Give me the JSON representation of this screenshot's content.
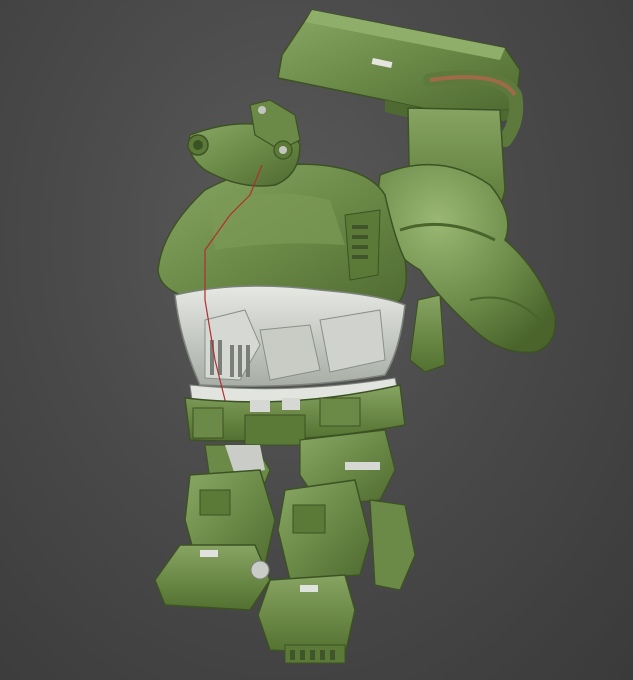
{
  "scene": {
    "background_color": "#4a4a4a",
    "model_primary_color": "#6b8a47",
    "model_dark_color": "#4f6a31",
    "model_light_color": "#8aa865",
    "armor_color": "#c9cdc8",
    "seam_color": "#b03030"
  }
}
